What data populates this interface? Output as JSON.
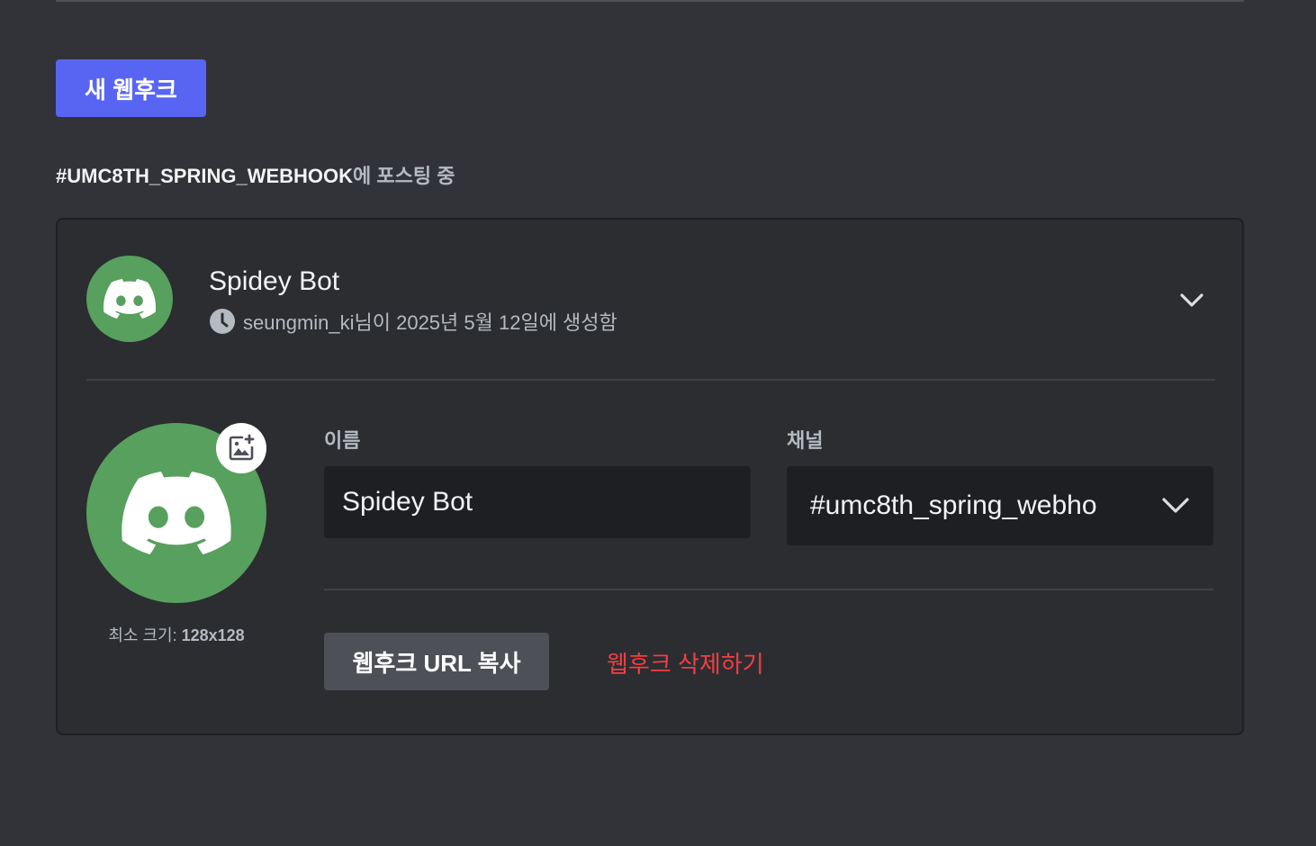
{
  "toolbar": {
    "new_webhook_label": "새 웹후크"
  },
  "posting": {
    "channel": "#UMC8TH_SPRING_WEBHOOK",
    "suffix": "에 포스팅 중"
  },
  "webhook": {
    "name": "Spidey Bot",
    "created_text": "seungmin_ki님이 2025년 5월 12일에 생성함",
    "avatar_icon": "discord-logo-icon",
    "avatar_color": "#57a05d",
    "min_size_prefix": "최소 크기: ",
    "min_size_value": "128x128",
    "name_field": {
      "label": "이름",
      "value": "Spidey Bot"
    },
    "channel_field": {
      "label": "채널",
      "value": "#umc8th_spring_webho"
    },
    "copy_url_label": "웹후크 URL 복사",
    "delete_label": "웹후크 삭제하기"
  },
  "colors": {
    "accent": "#5865f2",
    "danger": "#f23f43",
    "background": "#313338",
    "card": "#2b2d31",
    "input": "#1e1f22"
  }
}
